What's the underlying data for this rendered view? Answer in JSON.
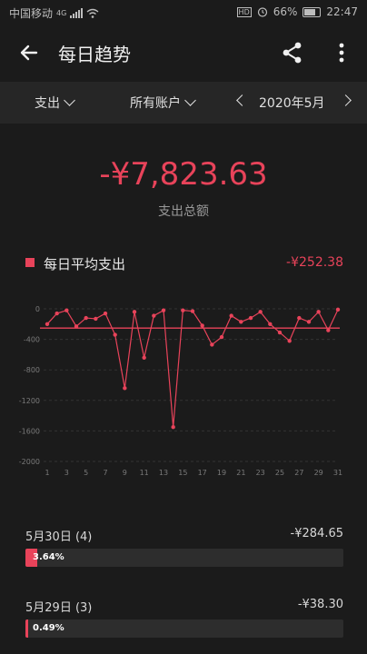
{
  "status_bar": {
    "carrier": "中国移动",
    "signal_label": "4G",
    "battery": "66%",
    "time": "22:47"
  },
  "app_bar": {
    "title": "每日趋势",
    "back_icon": "back-arrow-icon",
    "share_icon": "share-icon",
    "more_icon": "more-vert-icon"
  },
  "filters": {
    "type_label": "支出",
    "account_label": "所有账户",
    "month_label": "2020年5月"
  },
  "summary": {
    "total": "-¥7,823.63",
    "total_label": "支出总额",
    "avg_label": "每日平均支出",
    "avg_value": "-¥252.38"
  },
  "colors": {
    "accent": "#e8435a",
    "background": "#1b1b1b",
    "bar_track": "#2d2d2d"
  },
  "chart_data": {
    "type": "line",
    "y_ticks": [
      "-2000",
      "-1600",
      "-1200",
      "-800",
      "-400",
      "0"
    ],
    "x_ticks": [
      "1",
      "3",
      "5",
      "7",
      "9",
      "11",
      "13",
      "15",
      "17",
      "19",
      "21",
      "23",
      "25",
      "27",
      "29",
      "31"
    ],
    "x": [
      1,
      2,
      3,
      4,
      5,
      6,
      7,
      8,
      9,
      10,
      11,
      12,
      13,
      14,
      15,
      16,
      17,
      18,
      19,
      20,
      21,
      22,
      23,
      24,
      25,
      26,
      27,
      28,
      29,
      30,
      31
    ],
    "values": [
      -200,
      -60,
      -20,
      -230,
      -120,
      -130,
      -60,
      -340,
      -1040,
      -40,
      -640,
      -90,
      -20,
      -1550,
      -20,
      -30,
      -220,
      -470,
      -370,
      -90,
      -170,
      -120,
      -40,
      -200,
      -310,
      -420,
      -120,
      -170,
      -40,
      -280,
      -10
    ],
    "average": -252.38,
    "ylim": [
      -2000,
      0
    ]
  },
  "items": [
    {
      "date_label": "5月30日 (4)",
      "amount": "-¥284.65",
      "percent_label": "3.64%",
      "fraction": 0.0364
    },
    {
      "date_label": "5月29日 (3)",
      "amount": "-¥38.30",
      "percent_label": "0.49%",
      "fraction": 0.0049
    }
  ]
}
